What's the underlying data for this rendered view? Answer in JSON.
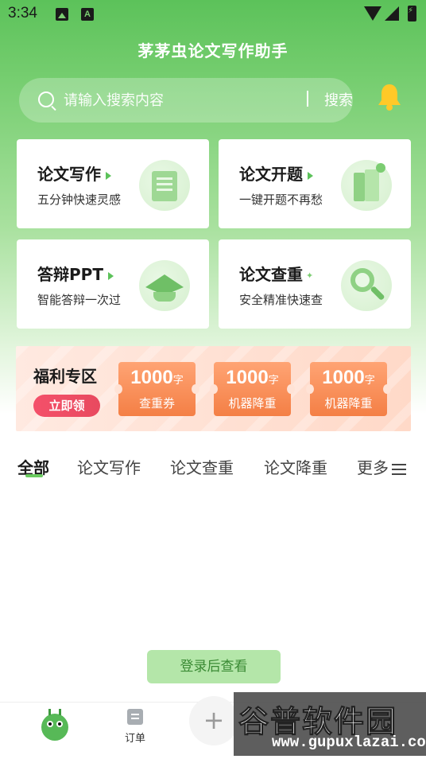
{
  "status_bar": {
    "time": "3:34",
    "badge_letter": "A"
  },
  "header": {
    "title": "茅茅虫论文写作助手"
  },
  "search": {
    "placeholder": "请输入搜索内容",
    "button_label": "搜索"
  },
  "cards": [
    {
      "title": "论文写作",
      "subtitle": "五分钟快速灵感",
      "icon": "document-icon"
    },
    {
      "title": "论文开题",
      "subtitle": "一键开题不再愁",
      "icon": "folder-icon"
    },
    {
      "title": "答辩PPT",
      "subtitle": "智能答辩一次过",
      "icon": "graduation-cap-icon"
    },
    {
      "title": "论文查重",
      "subtitle": "安全精准快速查",
      "icon": "magnifier-icon"
    }
  ],
  "welfare": {
    "title": "福利专区",
    "claim_label": "立即领",
    "coupons": [
      {
        "amount": "1000",
        "unit": "字",
        "label": "查重券"
      },
      {
        "amount": "1000",
        "unit": "字",
        "label": "机器降重"
      },
      {
        "amount": "1000",
        "unit": "字",
        "label": "机器降重"
      }
    ]
  },
  "tabs": [
    {
      "label": "全部",
      "active": true
    },
    {
      "label": "论文写作"
    },
    {
      "label": "论文查重"
    },
    {
      "label": "论文降重"
    },
    {
      "label": "更多"
    }
  ],
  "login_prompt": "登录后查看",
  "bottom_nav": {
    "orders_label": "订单"
  },
  "watermark": {
    "text": "谷普软件园",
    "url": "www.gupuxlazai.com"
  },
  "colors": {
    "primary": "#5cc25a",
    "coupon": "#f47f45",
    "claim": "#f4506a",
    "login_bg": "#b4e6a9"
  }
}
